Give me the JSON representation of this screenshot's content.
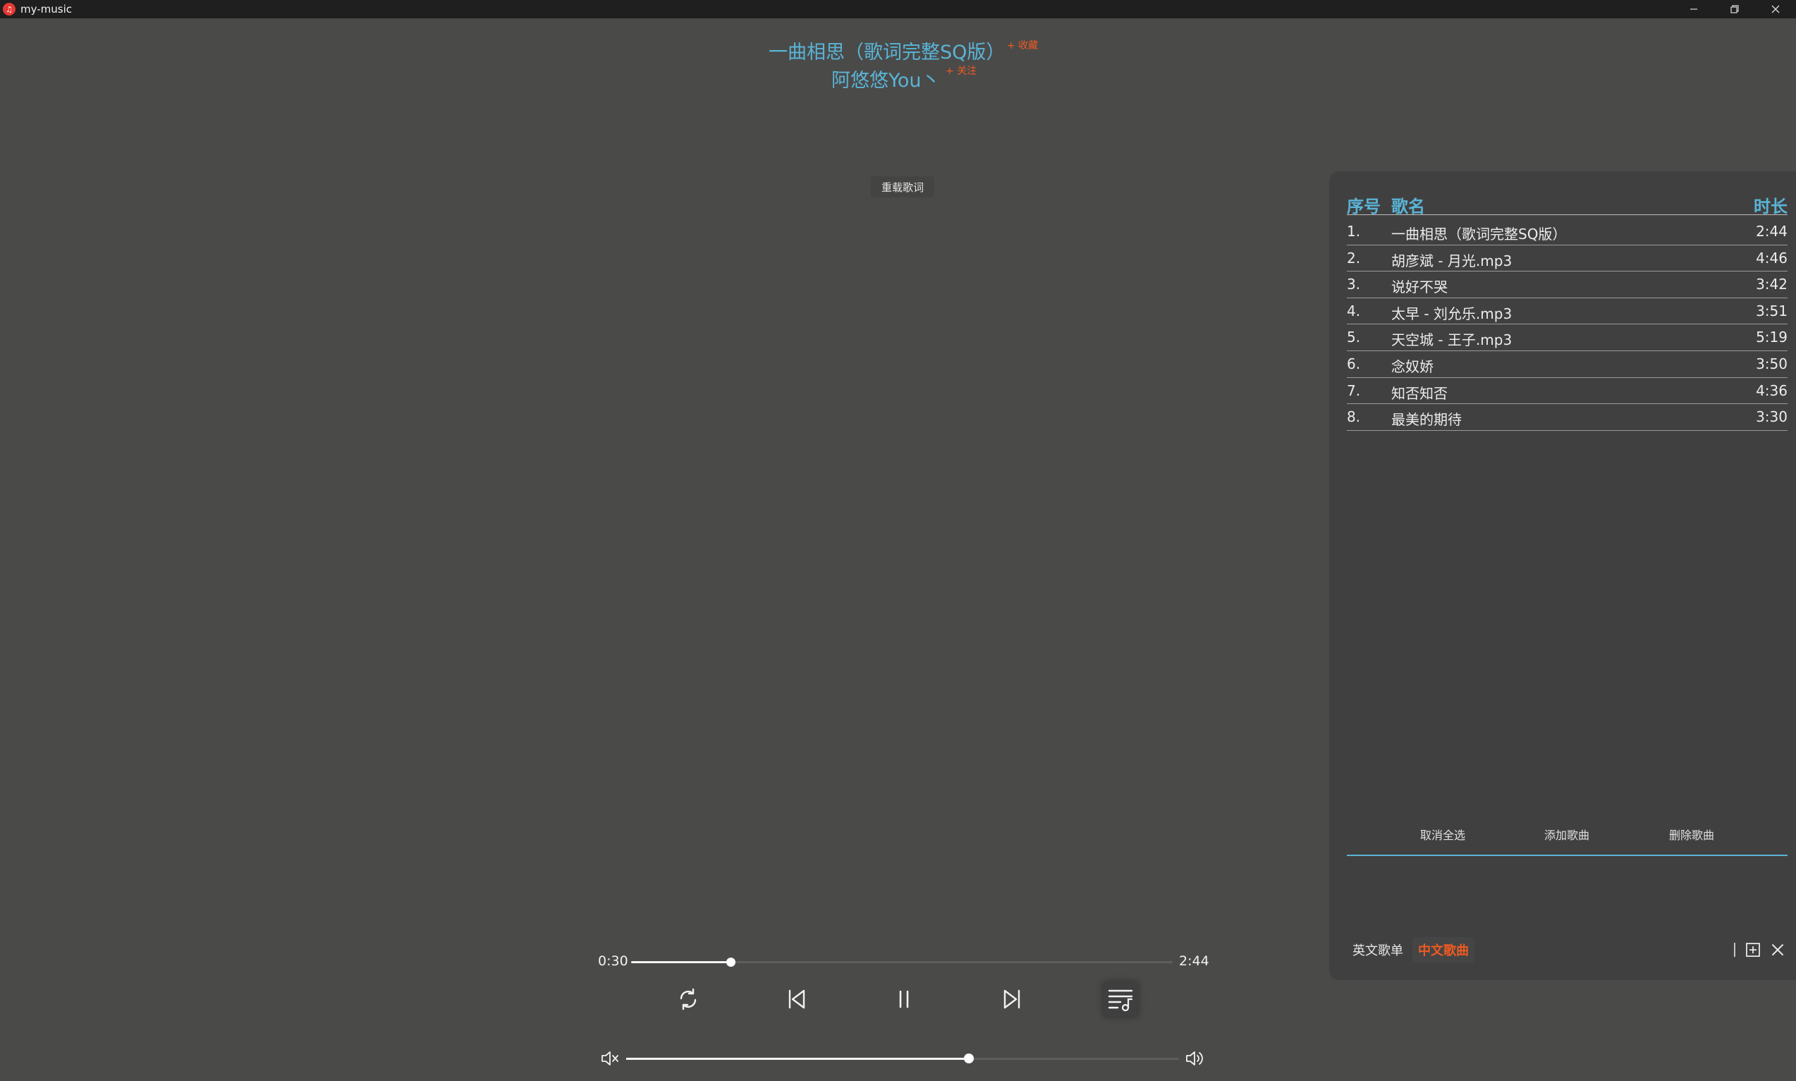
{
  "window": {
    "title": "my-music",
    "controls": {
      "minimize": "─",
      "restore": "❐",
      "close": "✕"
    }
  },
  "song": {
    "title": "一曲相思（歌词完整SQ版）",
    "collect_label": "+ 收藏",
    "artist": "阿悠悠You丶",
    "follow_label": "+ 关注"
  },
  "lyrics": {
    "reload_label": "重载歌词"
  },
  "playback": {
    "current_time": "0:30",
    "total_time": "2:44",
    "progress": 0.183,
    "volume": 0.62
  },
  "playlist": {
    "headers": {
      "index": "序号",
      "name": "歌名",
      "duration": "时长"
    },
    "songs": [
      {
        "index": "1.",
        "name": "一曲相思（歌词完整SQ版）",
        "duration": "2:44"
      },
      {
        "index": "2.",
        "name": "胡彦斌 - 月光.mp3",
        "duration": "4:46"
      },
      {
        "index": "3.",
        "name": "说好不哭",
        "duration": "3:42"
      },
      {
        "index": "4.",
        "name": "太早 - 刘允乐.mp3",
        "duration": "3:51"
      },
      {
        "index": "5.",
        "name": "天空城 - 王子.mp3",
        "duration": "5:19"
      },
      {
        "index": "6.",
        "name": "念奴娇",
        "duration": "3:50"
      },
      {
        "index": "7.",
        "name": "知否知否",
        "duration": "4:36"
      },
      {
        "index": "8.",
        "name": "最美的期待",
        "duration": "3:30"
      }
    ],
    "actions": {
      "deselect_all": "取消全选",
      "add_song": "添加歌曲",
      "delete_song": "删除歌曲"
    },
    "tabs": {
      "english": "英文歌单",
      "chinese": "中文歌曲"
    },
    "active_tab": "chinese"
  },
  "colors": {
    "accent_blue": "#5ab4d6",
    "accent_orange": "#f05a22",
    "background": "#4a4a49",
    "panel": "#404040"
  },
  "icons": {
    "app": "music-note-icon",
    "repeat": "repeat-icon",
    "previous": "skip-previous-icon",
    "pause": "pause-icon",
    "next": "skip-next-icon",
    "playlist": "playlist-icon",
    "mute": "volume-mute-icon",
    "volume": "volume-up-icon",
    "add_list": "add-box-icon",
    "close_panel": "close-icon"
  }
}
